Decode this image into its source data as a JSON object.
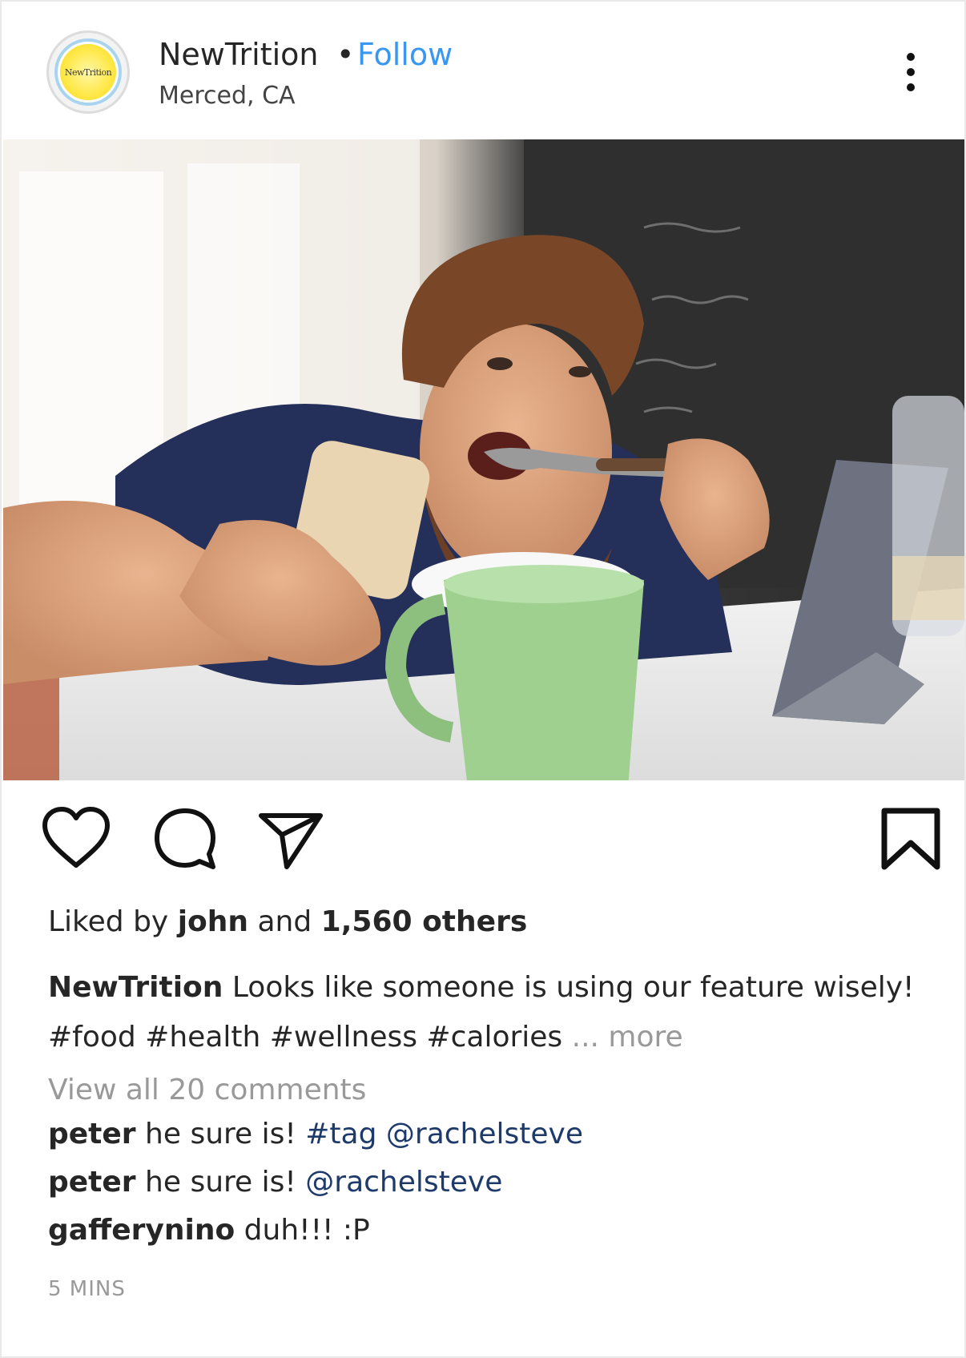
{
  "header": {
    "account_name": "NewTrition",
    "separator": "•",
    "follow_label": "Follow",
    "location": "Merced, CA",
    "avatar_text": "NewTrition"
  },
  "post": {
    "likes": {
      "prefix": "Liked by",
      "user": "john",
      "conj": "and",
      "count": "1,560 others"
    },
    "caption": {
      "author": "NewTrition",
      "text": "Looks like someone is using our feature wisely!",
      "hashtags": "#food #health #wellness #calories",
      "more_label": "... more"
    },
    "view_all_comments": "View all 20 comments",
    "comments": [
      {
        "user": "peter",
        "text": "he sure is!",
        "links": "#tag @rachelsteve"
      },
      {
        "user": "peter",
        "text": "he sure is!",
        "links": "@rachelsteve"
      },
      {
        "user": "gafferynino",
        "text": "duh!!! :P",
        "links": ""
      }
    ],
    "timestamp": "5 MINS"
  },
  "icons": {
    "like": "heart-icon",
    "comment": "comment-icon",
    "share": "share-icon",
    "save": "bookmark-icon",
    "more": "more-options-icon"
  },
  "colors": {
    "follow": "#3897f0",
    "mention_link": "#1e3a6a",
    "muted_text": "#999999"
  }
}
